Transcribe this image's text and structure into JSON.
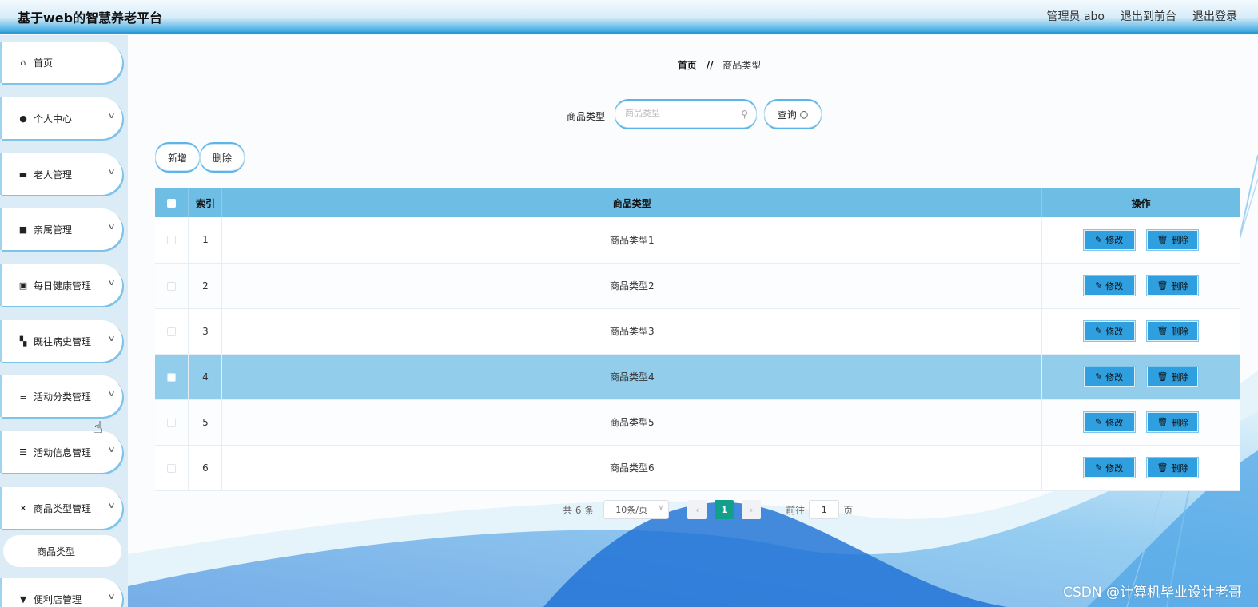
{
  "header": {
    "title": "基于web的智慧养老平台",
    "user": "管理员 abo",
    "to_front": "退出到前台",
    "logout": "退出登录"
  },
  "sidebar": {
    "items": [
      {
        "label": "首页",
        "icon": "home-icon",
        "has_arrow": false
      },
      {
        "label": "个人中心",
        "icon": "person-icon",
        "has_arrow": true
      },
      {
        "label": "老人管理",
        "icon": "briefcase-icon",
        "has_arrow": true
      },
      {
        "label": "亲属管理",
        "icon": "bus-icon",
        "has_arrow": true
      },
      {
        "label": "每日健康管理",
        "icon": "clipboard-icon",
        "has_arrow": true
      },
      {
        "label": "既往病史管理",
        "icon": "grid-icon",
        "has_arrow": true
      },
      {
        "label": "活动分类管理",
        "icon": "list-icon",
        "has_arrow": true
      },
      {
        "label": "活动信息管理",
        "icon": "sliders-icon",
        "has_arrow": true
      },
      {
        "label": "商品类型管理",
        "icon": "ticket-icon",
        "has_arrow": true
      },
      {
        "label": "便利店管理",
        "icon": "store-icon",
        "has_arrow": true
      }
    ],
    "submenu": {
      "label": "商品类型"
    }
  },
  "breadcrumb": {
    "home": "首页",
    "separator": "//",
    "current": "商品类型"
  },
  "search": {
    "label": "商品类型",
    "placeholder": "商品类型",
    "button": "查询"
  },
  "actions": {
    "add": "新增",
    "delete": "删除"
  },
  "table": {
    "headers": {
      "index": "索引",
      "type": "商品类型",
      "ops": "操作"
    },
    "rows": [
      {
        "index": "1",
        "type": "商品类型1"
      },
      {
        "index": "2",
        "type": "商品类型2"
      },
      {
        "index": "3",
        "type": "商品类型3"
      },
      {
        "index": "4",
        "type": "商品类型4"
      },
      {
        "index": "5",
        "type": "商品类型5"
      },
      {
        "index": "6",
        "type": "商品类型6"
      }
    ],
    "edit_label": "修改",
    "delete_label": "删除",
    "highlight_row": 4
  },
  "pagination": {
    "total": "共 6 条",
    "page_size": "10条/页",
    "current_page": "1",
    "goto_label": "前往",
    "goto_value": "1",
    "page_unit": "页"
  },
  "watermark": "CSDN @计算机毕业设计老哥",
  "colors": {
    "accent": "#2f9fdf",
    "header_bar": "#39a6e0",
    "active_page": "#12a08a",
    "highlight_row": "#92cdec"
  }
}
